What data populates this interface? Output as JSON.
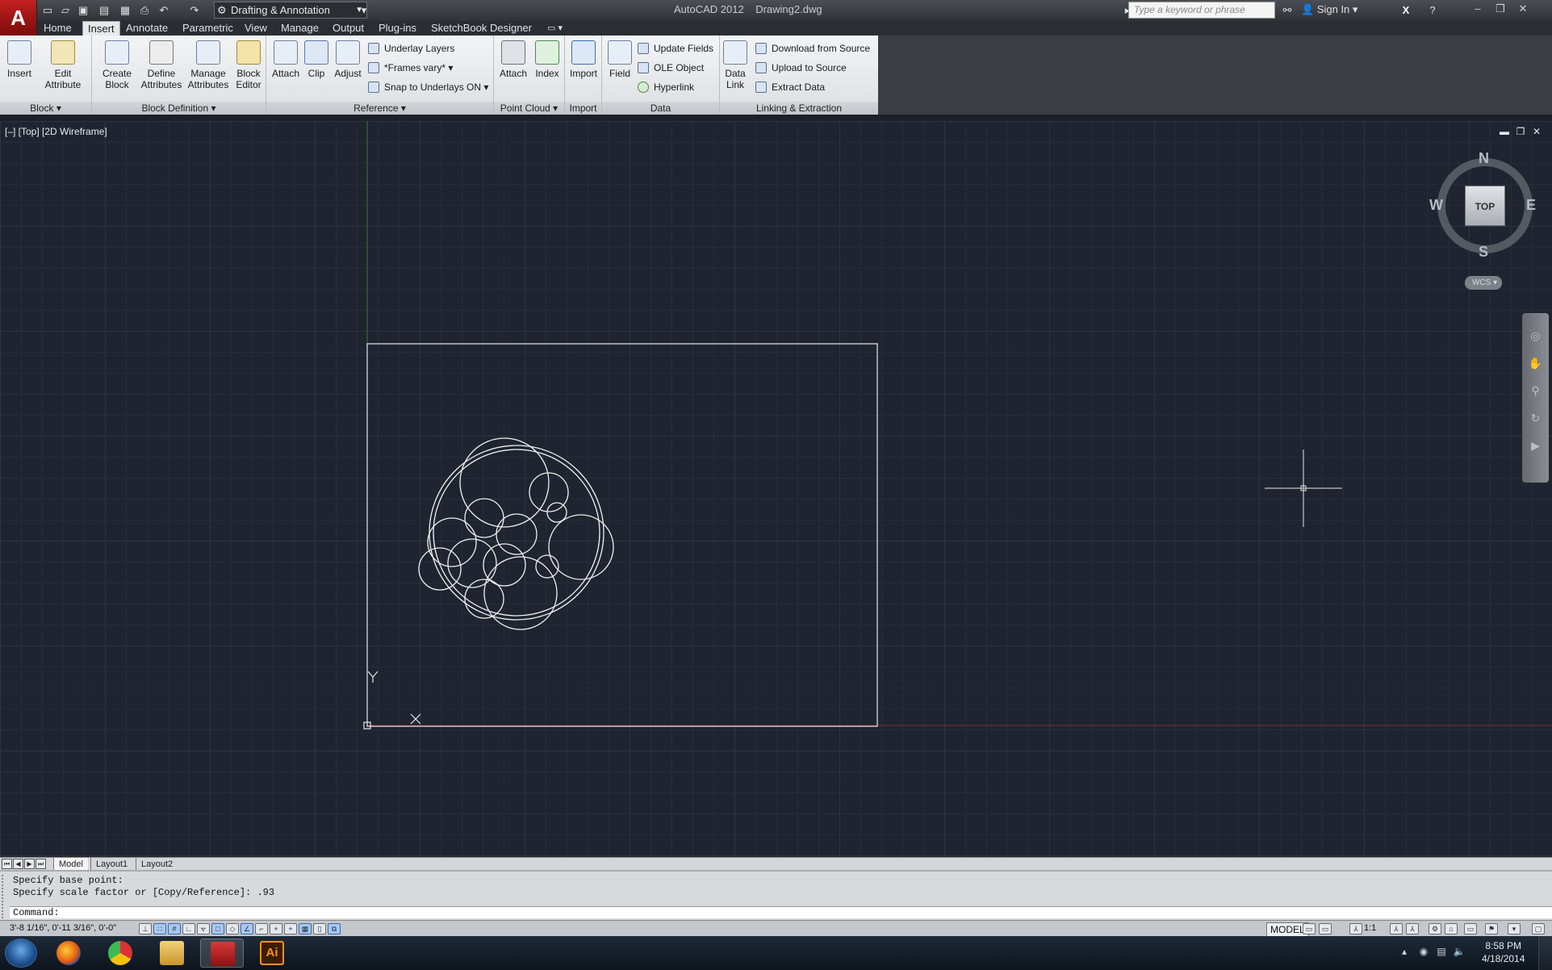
{
  "app": {
    "title": "AutoCAD 2012",
    "document": "Drawing2.dwg",
    "logo_letter": "A",
    "workspace": "Drafting & Annotation",
    "search_placeholder": "Type a keyword or phrase",
    "sign_in": "Sign In"
  },
  "tabs": [
    "Home",
    "Insert",
    "Annotate",
    "Parametric",
    "View",
    "Manage",
    "Output",
    "Plug-ins",
    "SketchBook Designer"
  ],
  "ribbon": {
    "block": {
      "title": "Block",
      "insert": "Insert",
      "edit_attribute_1": "Edit",
      "edit_attribute_2": "Attribute"
    },
    "block_definition": {
      "title": "Block Definition",
      "create_1": "Create",
      "create_2": "Block",
      "define_1": "Define",
      "define_2": "Attributes",
      "manage_1": "Manage",
      "manage_2": "Attributes",
      "editor_1": "Block",
      "editor_2": "Editor"
    },
    "reference": {
      "title": "Reference",
      "attach": "Attach",
      "clip": "Clip",
      "adjust": "Adjust",
      "underlay_layers": "Underlay Layers",
      "frames": "*Frames vary*",
      "snap": "Snap to Underlays ON"
    },
    "point_cloud": {
      "title": "Point Cloud",
      "attach": "Attach",
      "index": "Index"
    },
    "import": {
      "title": "Import",
      "import": "Import"
    },
    "data": {
      "title": "Data",
      "field": "Field",
      "update_fields": "Update Fields",
      "ole_object": "OLE Object",
      "hyperlink": "Hyperlink"
    },
    "linking": {
      "title": "Linking & Extraction",
      "data_link_1": "Data",
      "data_link_2": "Link",
      "download": "Download from Source",
      "upload": "Upload to Source",
      "extract": "Extract  Data"
    }
  },
  "viewport": {
    "label": "[–] [Top] [2D Wireframe]",
    "compass": {
      "n": "N",
      "s": "S",
      "e": "E",
      "w": "W",
      "top": "TOP"
    },
    "wcs": "WCS",
    "ucs_y": "Y",
    "ucs_x": "X"
  },
  "layout_tabs": [
    "Model",
    "Layout1",
    "Layout2"
  ],
  "command": {
    "history": [
      "Specify base point:",
      "Specify scale factor or [Copy/Reference]: .93"
    ],
    "prompt": "Command:"
  },
  "status": {
    "coords": "3'-8 1/16\",  0'-11 3/16\", 0'-0\"",
    "model": "MODEL",
    "annotation_scale": "1:1"
  },
  "taskbar": {
    "time": "8:58 PM",
    "date": "4/18/2014",
    "illustrator_label": "Ai"
  },
  "colors": {
    "viewport_bg": "#1f2430",
    "accent_red": "#c41f1f",
    "ribbon_bg": "#e7e8ea"
  },
  "icons": [
    "new-icon",
    "open-icon",
    "save-icon",
    "saveas-icon",
    "plot-icon",
    "undo-icon",
    "redo-icon",
    "binoculars-icon",
    "user-icon",
    "exchange-icon",
    "help-icon"
  ]
}
